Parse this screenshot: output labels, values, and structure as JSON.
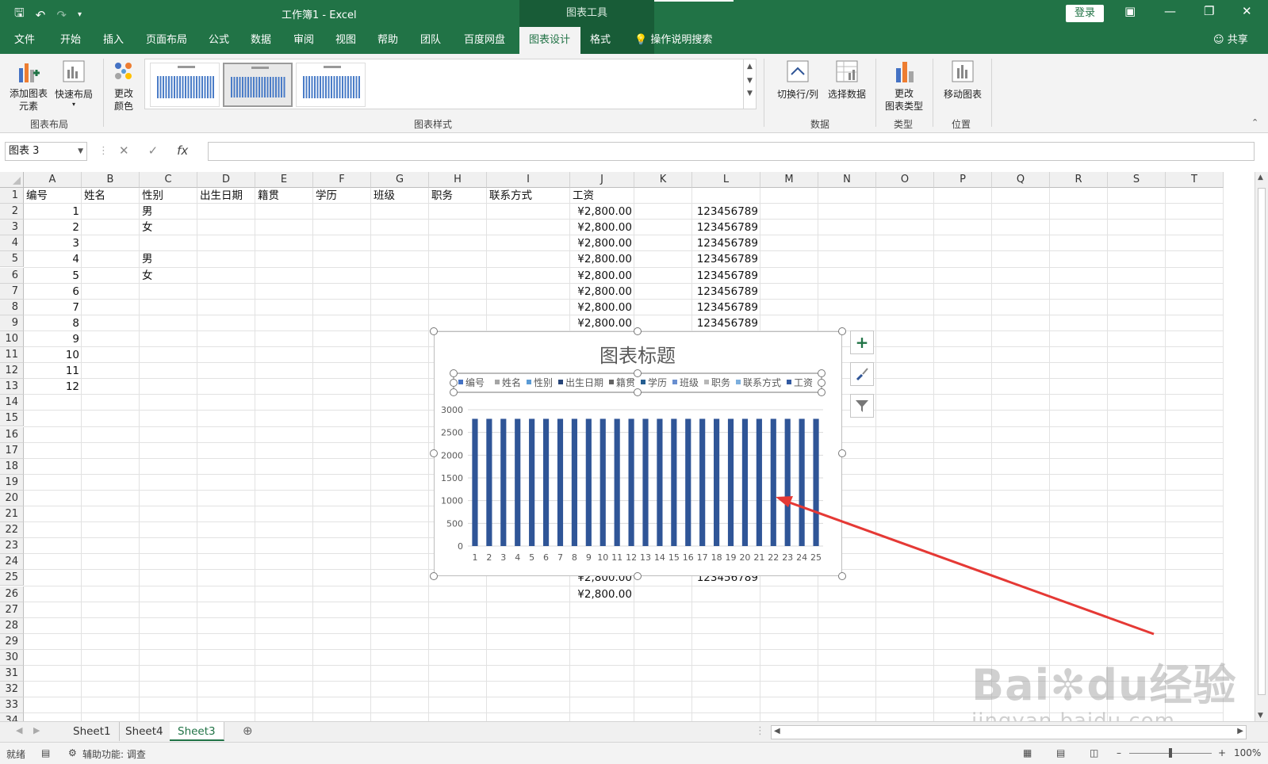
{
  "titlebar": {
    "title": "工作簿1  -  Excel",
    "context_tool": "图表工具",
    "login": "登录"
  },
  "tabs": [
    "文件",
    "开始",
    "插入",
    "页面布局",
    "公式",
    "数据",
    "审阅",
    "视图",
    "帮助",
    "团队",
    "百度网盘",
    "图表设计",
    "格式"
  ],
  "active_tab": "图表设计",
  "search_placeholder": "操作说明搜索",
  "share_label": "共享",
  "ribbon": {
    "add_element": "添加图表\n元素",
    "quick_layout": "快速布局",
    "change_color": "更改\n颜色",
    "switch_rowcol": "切换行/列",
    "select_data": "选择数据",
    "change_type": "更改\n图表类型",
    "move_chart": "移动图表",
    "groups": {
      "layout": "图表布局",
      "styles": "图表样式",
      "data": "数据",
      "type": "类型",
      "location": "位置"
    }
  },
  "namebox": "图表 3",
  "formula": "",
  "columns": [
    "A",
    "B",
    "C",
    "D",
    "E",
    "F",
    "G",
    "H",
    "I",
    "J",
    "K",
    "L",
    "M",
    "N",
    "O",
    "P",
    "Q",
    "R",
    "S",
    "T"
  ],
  "header_row": [
    "编号",
    "姓名",
    "性别",
    "出生日期",
    "籍贯",
    "学历",
    "班级",
    "职务",
    "联系方式",
    "工资"
  ],
  "data_rows": [
    {
      "id": "1",
      "gender": "男",
      "salary": "¥2,800.00",
      "phone": "123456789"
    },
    {
      "id": "2",
      "gender": "女",
      "salary": "¥2,800.00",
      "phone": "123456789"
    },
    {
      "id": "3",
      "gender": "",
      "salary": "¥2,800.00",
      "phone": "123456789"
    },
    {
      "id": "4",
      "gender": "男",
      "salary": "¥2,800.00",
      "phone": "123456789"
    },
    {
      "id": "5",
      "gender": "女",
      "salary": "¥2,800.00",
      "phone": "123456789"
    },
    {
      "id": "6",
      "gender": "",
      "salary": "¥2,800.00",
      "phone": "123456789"
    },
    {
      "id": "7",
      "gender": "",
      "salary": "¥2,800.00",
      "phone": "123456789"
    },
    {
      "id": "8",
      "gender": "",
      "salary": "¥2,800.00",
      "phone": "123456789"
    },
    {
      "id": "9",
      "gender": "",
      "salary": "",
      "phone": ""
    },
    {
      "id": "10",
      "gender": "",
      "salary": "",
      "phone": ""
    },
    {
      "id": "11",
      "gender": "",
      "salary": "",
      "phone": ""
    },
    {
      "id": "12",
      "gender": "",
      "salary": "",
      "phone": ""
    }
  ],
  "row_25": {
    "salary": "¥2,800.00",
    "phone": "123456789"
  },
  "row_26": {
    "salary": "¥2,800.00"
  },
  "chart_data": {
    "type": "bar",
    "title": "图表标题",
    "legend": [
      "编号",
      "姓名",
      "性别",
      "出生日期",
      "籍贯",
      "学历",
      "班级",
      "职务",
      "联系方式",
      "工资"
    ],
    "legend_colors": [
      "#4472c4",
      "#a5a5a5",
      "#5b9bd5",
      "#264478",
      "#636363",
      "#255e91",
      "#698ed0",
      "#b7b7b7",
      "#7cafdd",
      "#335aa1"
    ],
    "categories": [
      "1",
      "2",
      "3",
      "4",
      "5",
      "6",
      "7",
      "8",
      "9",
      "10",
      "11",
      "12",
      "13",
      "14",
      "15",
      "16",
      "17",
      "18",
      "19",
      "20",
      "21",
      "22",
      "23",
      "24",
      "25"
    ],
    "series": [
      {
        "name": "工资",
        "values": [
          2800,
          2800,
          2800,
          2800,
          2800,
          2800,
          2800,
          2800,
          2800,
          2800,
          2800,
          2800,
          2800,
          2800,
          2800,
          2800,
          2800,
          2800,
          2800,
          2800,
          2800,
          2800,
          2800,
          2800,
          2800
        ]
      }
    ],
    "ylim": [
      0,
      3000
    ],
    "yticks": [
      "0",
      "500",
      "1000",
      "1500",
      "2000",
      "2500",
      "3000"
    ],
    "bar_color": "#2f5597",
    "grid": true,
    "legend_position": "top"
  },
  "sheets": [
    "Sheet1",
    "Sheet4",
    "Sheet3"
  ],
  "active_sheet": "Sheet3",
  "status": {
    "ready": "就绪",
    "accessibility": "辅助功能: 调查",
    "zoom": "100%"
  },
  "watermark": {
    "text1": "Bai",
    "text2": "du经验",
    "url": "jingyan.baidu.com"
  },
  "colors": {
    "excel_green": "#217346",
    "arrow_red": "#e53935"
  }
}
